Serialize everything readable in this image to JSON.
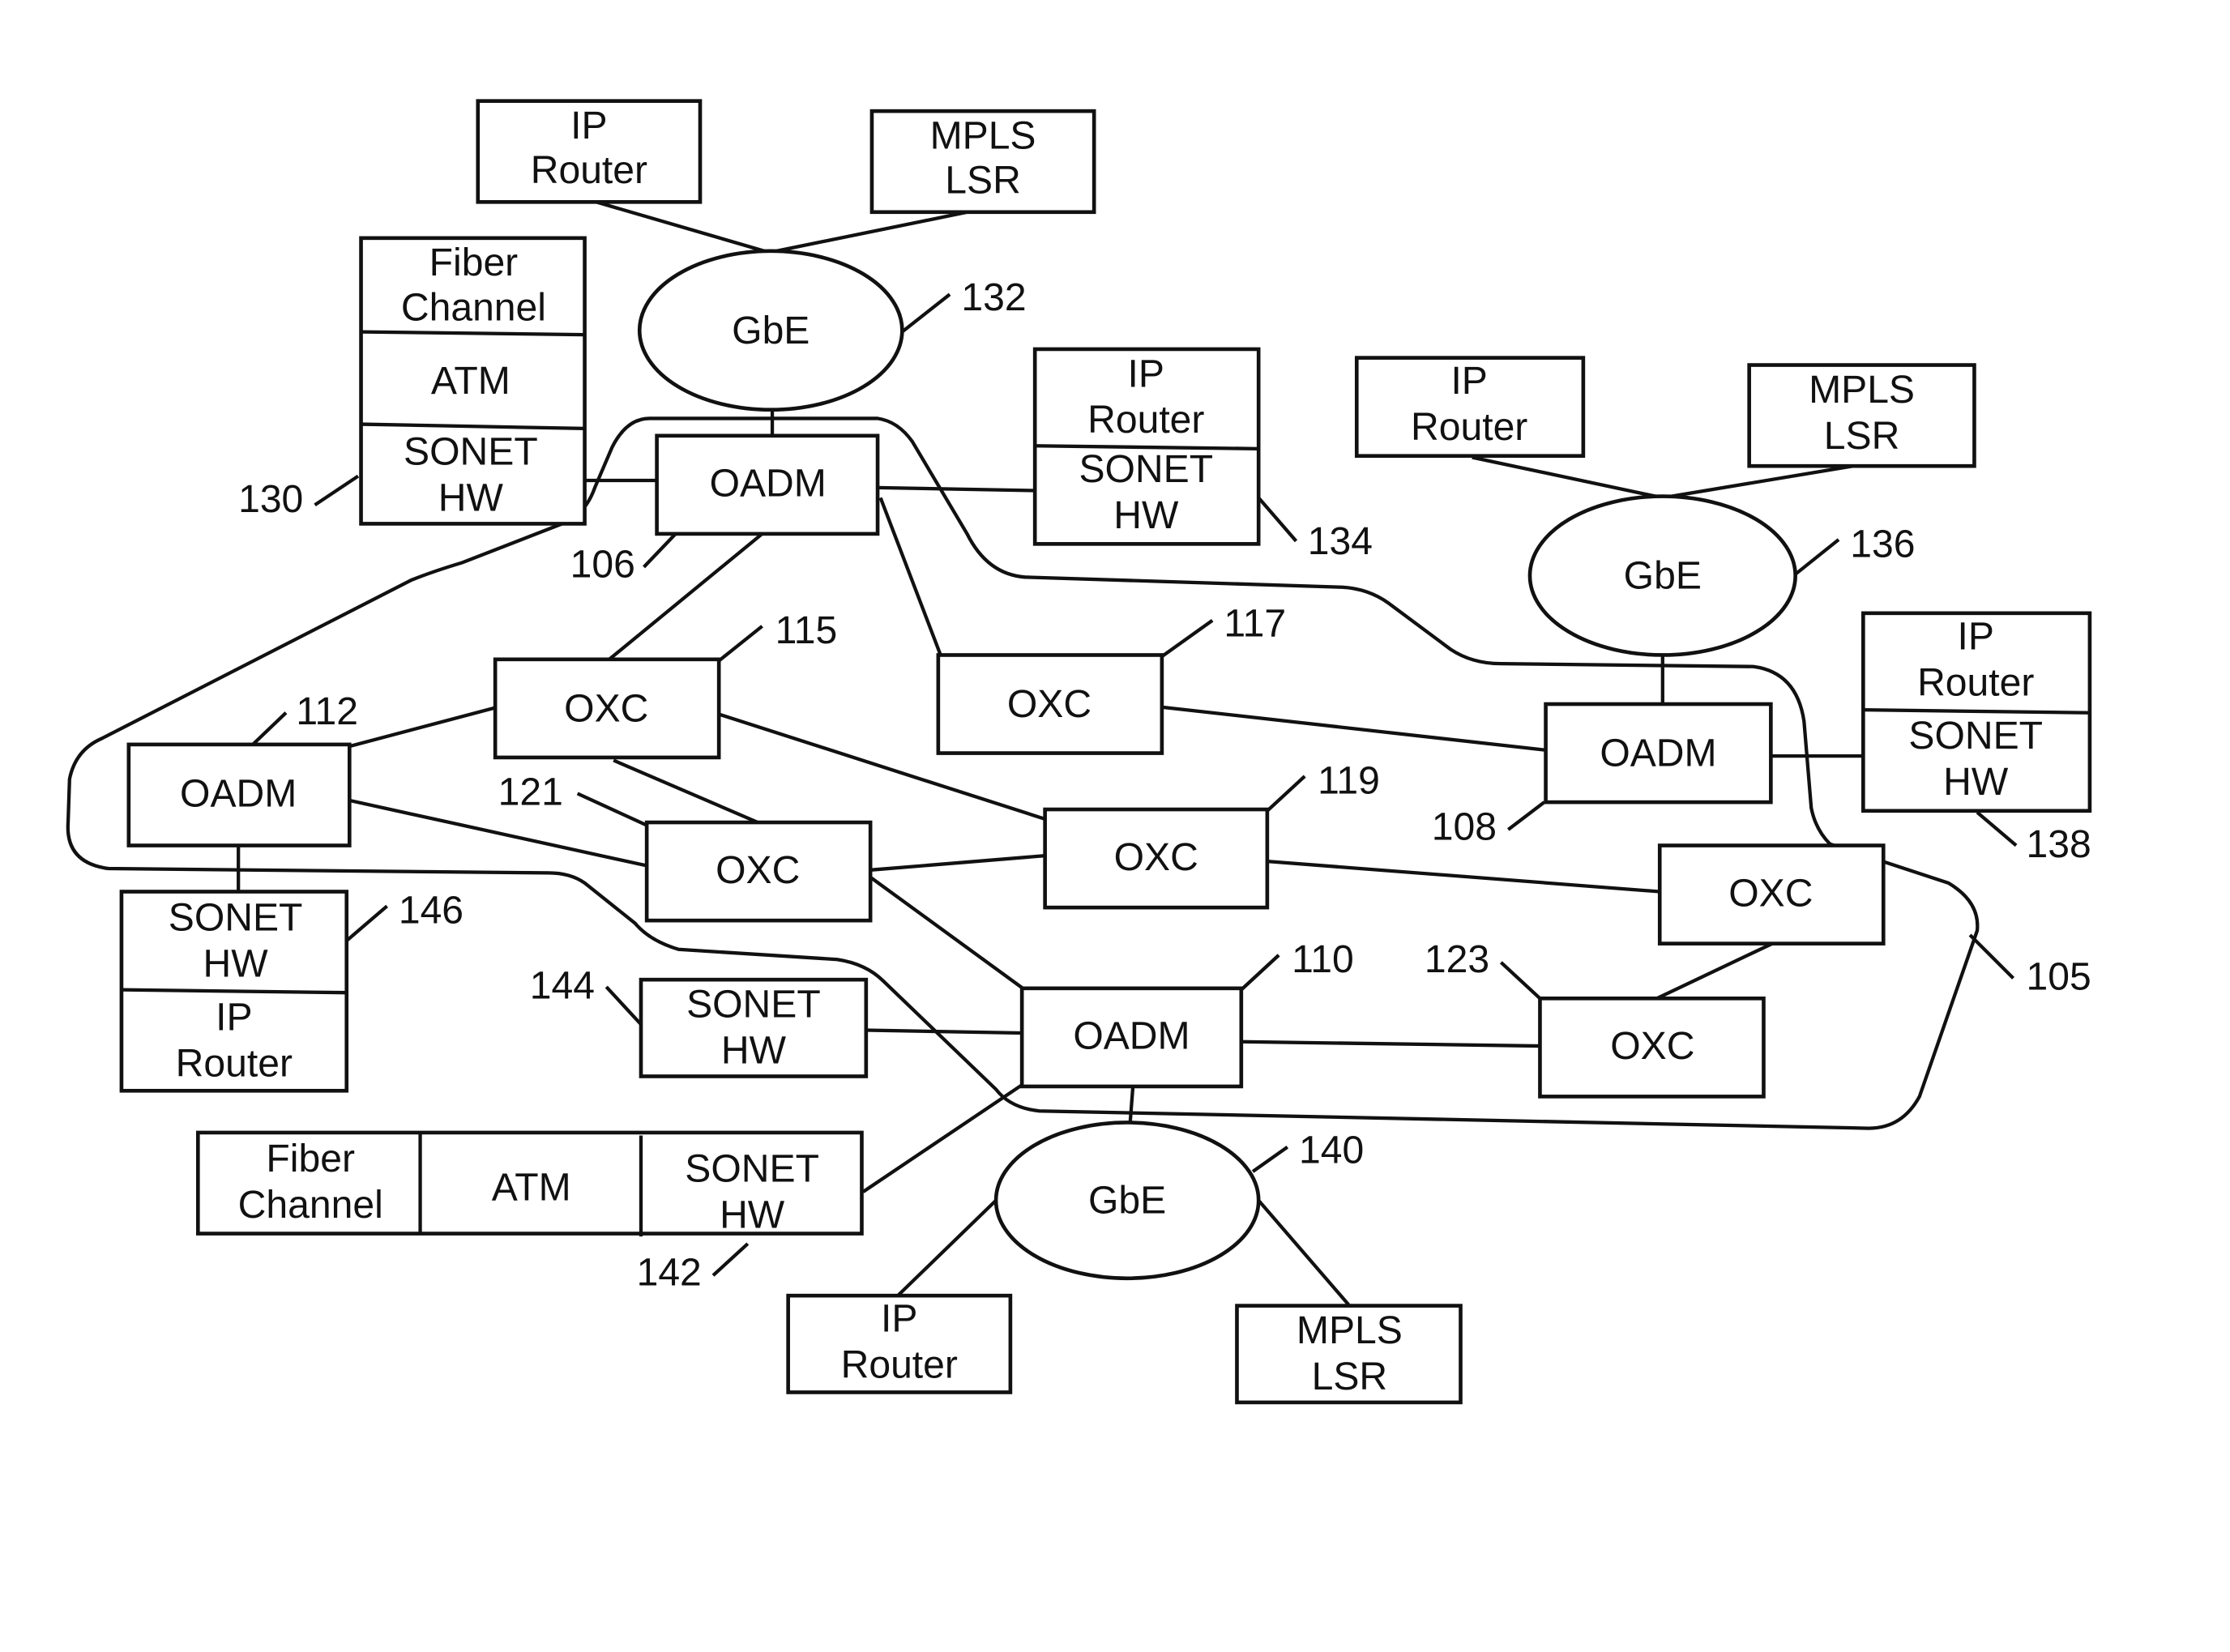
{
  "diagram": {
    "type": "optical network topology",
    "ring_label": "105",
    "nodes": {
      "oadm_106": {
        "label": "OADM",
        "ref": "106"
      },
      "oadm_108": {
        "label": "OADM",
        "ref": "108"
      },
      "oadm_110": {
        "label": "OADM",
        "ref": "110"
      },
      "oadm_112": {
        "label": "OADM",
        "ref": "112"
      },
      "oxc_115": {
        "label": "OXC",
        "ref": "115"
      },
      "oxc_117": {
        "label": "OXC",
        "ref": "117"
      },
      "oxc_119": {
        "label": "OXC",
        "ref": "119"
      },
      "oxc_121": {
        "label": "OXC",
        "ref": "121"
      },
      "oxc_123": {
        "label": "OXC",
        "ref": "123"
      },
      "oxc_right": {
        "label": "OXC"
      },
      "gbe_132": {
        "label": "GbE",
        "ref": "132"
      },
      "gbe_136": {
        "label": "GbE",
        "ref": "136"
      },
      "gbe_140": {
        "label": "GbE",
        "ref": "140"
      }
    },
    "clients": {
      "c130": {
        "ref": "130",
        "rows": [
          [
            "Fiber",
            "Channel"
          ],
          [
            "ATM"
          ],
          [
            "SONET",
            "HW"
          ]
        ]
      },
      "c134": {
        "ref": "134",
        "rows": [
          [
            "IP",
            "Router"
          ],
          [
            "SONET",
            "HW"
          ]
        ]
      },
      "c138": {
        "ref": "138",
        "rows": [
          [
            "IP",
            "Router"
          ],
          [
            "SONET",
            "HW"
          ]
        ]
      },
      "c146": {
        "ref": "146",
        "rows": [
          [
            "SONET",
            "HW"
          ],
          [
            "IP",
            "Router"
          ]
        ]
      },
      "c144": {
        "ref": "144",
        "rows": [
          [
            "SONET",
            "HW"
          ]
        ]
      },
      "c142": {
        "ref": "142",
        "cols": [
          [
            "Fiber",
            "Channel"
          ],
          [
            "ATM"
          ],
          [
            "SONET",
            "HW"
          ]
        ]
      },
      "ip_router": [
        "IP",
        "Router"
      ],
      "mpls_lsr": [
        "MPLS",
        "LSR"
      ]
    }
  }
}
